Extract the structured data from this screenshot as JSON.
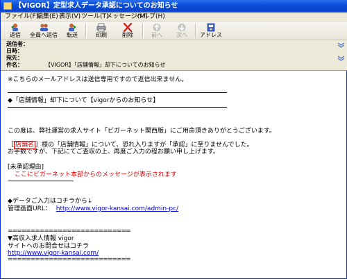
{
  "window": {
    "title": "【VIGOR】定型求人データ承認についてのお知らせ"
  },
  "menubar": [
    {
      "label": "ファイル(F)"
    },
    {
      "label": "編集(E)"
    },
    {
      "label": "表示(V)"
    },
    {
      "label": "ツール(T)"
    },
    {
      "label": "メッセージ(M)"
    },
    {
      "label": "ヘルプ(H)"
    }
  ],
  "toolbar": [
    {
      "label": "返信",
      "icon": "reply-icon",
      "enabled": true
    },
    {
      "label": "全員へ返信",
      "icon": "reply-all-icon",
      "enabled": true
    },
    {
      "label": "転送",
      "icon": "forward-icon",
      "enabled": true
    },
    {
      "label": "印刷",
      "icon": "print-icon",
      "enabled": true
    },
    {
      "label": "削除",
      "icon": "delete-icon",
      "enabled": true
    },
    {
      "label": "前へ",
      "icon": "previous-icon",
      "enabled": false
    },
    {
      "label": "次へ",
      "icon": "next-icon",
      "enabled": false
    },
    {
      "label": "アドレス",
      "icon": "address-book-icon",
      "enabled": true
    }
  ],
  "headers": {
    "from_label": "送信者：",
    "date_label": "日時：",
    "to_label": "宛先：",
    "subject_label": "件名：",
    "subject_value": "【VIGOR】「店舗情報」却下についてのお知らせ"
  },
  "body": {
    "notice": "※こちらのメールアドレスは送信専用ですので返信出来ません。",
    "heading": "◆「店舗情報」却下について【vigorからのお知らせ】",
    "thanks": "この度は、弊社運営の求人サイト「ビガーネット関西版」にご用命頂きありがとうございます。",
    "para1_prefix": "［",
    "shop_name": "店舗名",
    "para1_suffix": "］様の「店舗情報」について、恐れ入りますが「承認」に至りませんでした。",
    "para2": "お手数ですが、下記にてご査収の上、再度ご入力の程お願い申し上げます。",
    "reason_label": "[未承認理由]",
    "reason_message": "ここにビガーネット本部からのメッセージが表示されます",
    "reason_dash": "------------------------------------------",
    "data_entry": "◆データご入力はコチラから↓",
    "admin_label": "管理画面URL：",
    "admin_url": "http://www.vigor-kansai.com/admin-pc/",
    "equals_top": "===========================",
    "company": "▼高収入求人情報 vigor",
    "inquiry": "サイトへのお問合せはコチラ",
    "site_url": "http://www.vigor-kansai.com/",
    "equals_bottom": "==========================="
  },
  "colors": {
    "titlebar": "#0a4fd8",
    "warning_text": "#e00000",
    "link": "#0000cc"
  }
}
